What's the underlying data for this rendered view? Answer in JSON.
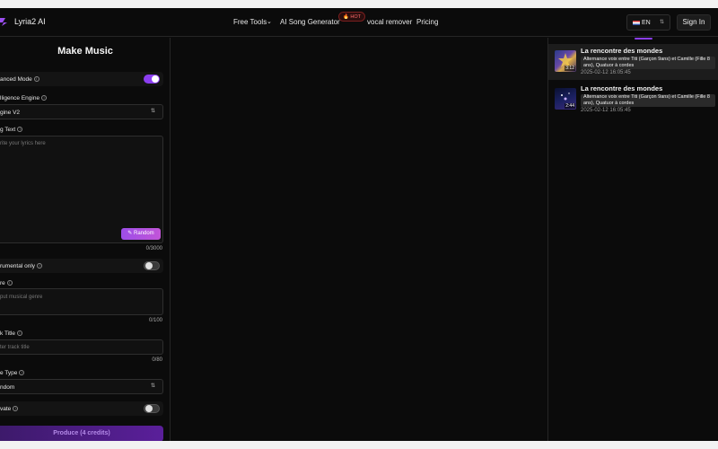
{
  "header": {
    "brand": "Lyria2 AI",
    "nav": {
      "free_tools": "Free Tools",
      "ai_song": "AI Song Generator",
      "hot_badge": "🔥 HOT",
      "vocal_remover": "vocal remover",
      "pricing": "Pricing"
    },
    "language": "EN",
    "sign_in": "Sign In"
  },
  "form": {
    "title": "Make Music",
    "advanced_mode": {
      "label": "anced Mode",
      "on": true
    },
    "engine": {
      "label": "lligence Engine",
      "value": "gine V2"
    },
    "song_text": {
      "label": "g Text",
      "placeholder": "rite your lyrics here",
      "counter": "0/3000",
      "random_label": "Random"
    },
    "instrumental": {
      "label": "rumental only",
      "on": false
    },
    "genre": {
      "label": "re",
      "placeholder": "put musical genre",
      "counter": "0/100"
    },
    "track_title": {
      "label": "k Title",
      "placeholder": "ter track title",
      "counter": "0/80"
    },
    "voice_type": {
      "label": "e Type",
      "value": "ndom"
    },
    "private": {
      "label": "vate",
      "on": false
    },
    "produce_label": "Produce (4 credits)"
  },
  "songs": [
    {
      "title": "La rencontre des mondes",
      "description": "Alternance voix entre Titi (Garçon 9ans) et Camille (Fille 8 ans), Quatuor à cordes",
      "date": "2025-02-12 16:05:45",
      "duration": "3:12"
    },
    {
      "title": "La rencontre des mondes",
      "description": "Alternance voix entre Titi (Garçon 9ans) et Camille (Fille 8 ans), Quatuor à cordes",
      "date": "2025-02-12 16:05:45",
      "duration": "2:44"
    }
  ],
  "colors": {
    "accent": "#8b3ef0",
    "background": "#0b0b0b",
    "hot": "#ff6b6b"
  }
}
